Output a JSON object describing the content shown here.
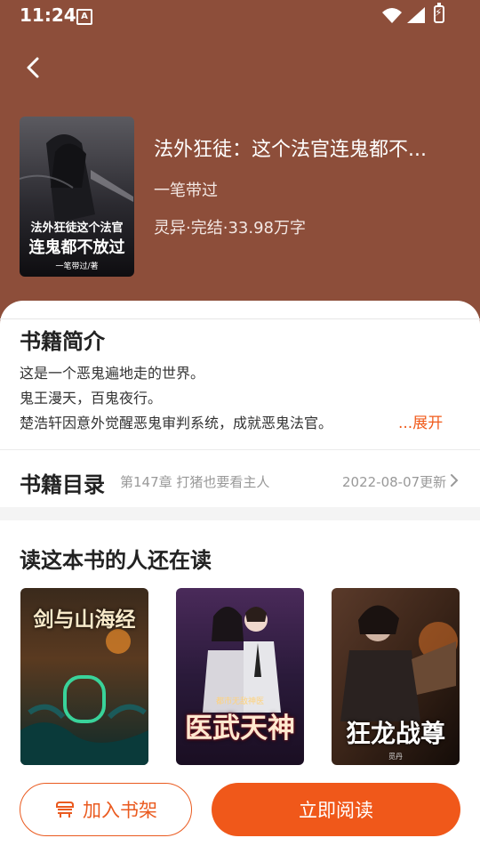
{
  "status_bar": {
    "time": "11:24",
    "a_icon": "A"
  },
  "header": {
    "cover_title_line1": "法外狂徒这个法官",
    "cover_title_line2": "连鬼都不放过",
    "cover_author": "一笔带过/著",
    "title": "法外狂徒：这个法官连鬼都不...",
    "author": "一笔带过",
    "meta": "灵异·完结·33.98万字"
  },
  "intro": {
    "heading": "书籍简介",
    "lines": [
      "这是一个恶鬼遍地走的世界。",
      "鬼王漫天，百鬼夜行。",
      "楚浩轩因意外觉醒恶鬼审判系统，成就恶鬼法官。"
    ],
    "expand_label": "...展开"
  },
  "catalog": {
    "heading": "书籍目录",
    "latest_chapter": "第147章 打猪也要看主人",
    "updated": "2022-08-07更新"
  },
  "also_reading": {
    "heading": "读这本书的人还在读",
    "books": [
      {
        "cover_text": "剑与山海经"
      },
      {
        "cover_small": "都市无敌神医",
        "cover_text": "医武天神"
      },
      {
        "cover_text": "狂龙战尊",
        "cover_small": "觅丹"
      }
    ]
  },
  "actions": {
    "shelf_label": "加入书架",
    "read_label": "立即阅读"
  },
  "colors": {
    "header_bg": "#8d4e3a",
    "accent": "#f0581a"
  }
}
